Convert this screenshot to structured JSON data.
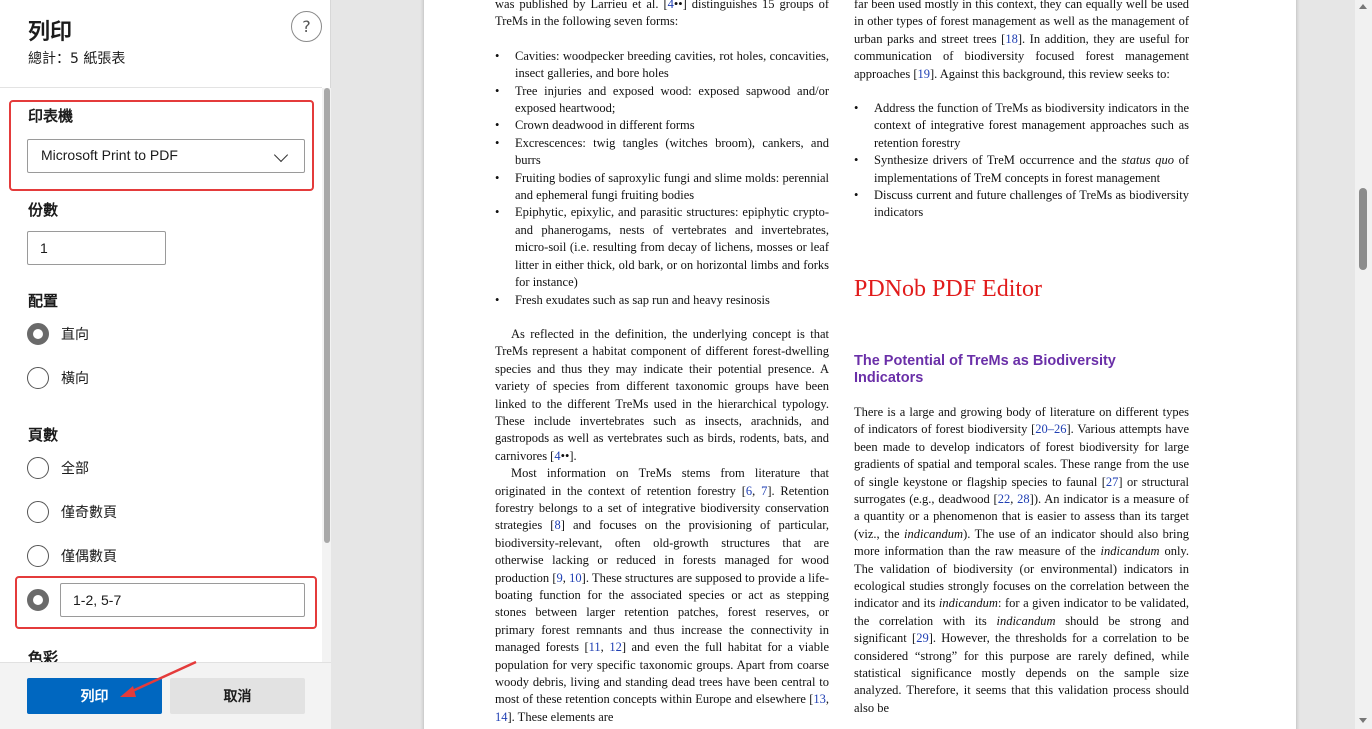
{
  "dialog": {
    "title": "列印",
    "total_sheets": "總計：5 紙張表",
    "help_icon": "question-mark-icon",
    "help_glyph": "?",
    "printer": {
      "label": "印表機",
      "value": "Microsoft Print to PDF"
    },
    "copies": {
      "label": "份數",
      "value": "1"
    },
    "layout": {
      "label": "配置",
      "options": [
        {
          "label": "直向",
          "checked": true
        },
        {
          "label": "橫向",
          "checked": false
        }
      ]
    },
    "pages": {
      "label": "頁數",
      "options": [
        {
          "label": "全部",
          "checked": false
        },
        {
          "label": "僅奇數頁",
          "checked": false
        },
        {
          "label": "僅偶數頁",
          "checked": false
        }
      ],
      "custom_checked": true,
      "custom_value": "1-2, 5-7"
    },
    "color": {
      "label": "色彩"
    },
    "print_label": "列印",
    "cancel_label": "取消",
    "highlight_color": "#e43b3b",
    "primary_color": "#0067c0"
  },
  "document": {
    "left": {
      "intro": [
        {
          "t": "was published by Larrieu et al. ["
        },
        {
          "t": "4",
          "ref": true
        },
        {
          "t": "••] distinguishes 15 groups of TreMs in the following seven forms:"
        }
      ],
      "bullets": [
        "Cavities: woodpecker breeding cavities, rot holes, concavities, insect galleries, and bore holes",
        "Tree injuries and exposed wood: exposed sapwood and/or exposed heartwood;",
        "Crown deadwood in different forms",
        "Excrescences: twig tangles (witches broom), cankers, and burrs",
        "Fruiting bodies of saproxylic fungi and slime molds: perennial and ephemeral fungi fruiting bodies",
        "Epiphytic, epixylic, and parasitic structures: epiphytic crypto- and phanerogams, nests of vertebrates and invertebrates, micro-soil (i.e. resulting from decay of lichens, mosses or leaf litter in either thick, old bark, or on horizontal limbs and forks for instance)",
        "Fresh exudates such as sap run and heavy resinosis"
      ],
      "para1": [
        {
          "t": "As reflected in the definition, the underlying concept is that TreMs represent a habitat component of different forest-dwelling species and thus they may indicate their potential presence. A variety of species from different taxonomic groups have been linked to the different TreMs used in the hierarchical typology. These include invertebrates such as insects, arachnids, and gastropods as well as vertebrates such as birds, rodents, bats, and carnivores ["
        },
        {
          "t": "4",
          "ref": true
        },
        {
          "t": "••]."
        }
      ],
      "para2": [
        {
          "t": "Most information on TreMs stems from literature that originated in the context of retention forestry ["
        },
        {
          "t": "6",
          "ref": true
        },
        {
          "t": ", "
        },
        {
          "t": "7",
          "ref": true
        },
        {
          "t": "]. Retention forestry belongs to a set of integrative biodiversity conservation strategies ["
        },
        {
          "t": "8",
          "ref": true
        },
        {
          "t": "] and focuses on the provisioning of particular, biodiversity-relevant, often old-growth structures that are otherwise lacking or reduced in forests managed for wood production ["
        },
        {
          "t": "9",
          "ref": true
        },
        {
          "t": ", "
        },
        {
          "t": "10",
          "ref": true
        },
        {
          "t": "]. These structures are supposed to provide a life-boating function for the associated species or act as stepping stones between larger retention patches, forest reserves, or primary forest remnants and thus increase the connectivity in managed forests ["
        },
        {
          "t": "11",
          "ref": true
        },
        {
          "t": ", "
        },
        {
          "t": "12",
          "ref": true
        },
        {
          "t": "] and even the full habitat for a viable population for very specific taxonomic groups. Apart from coarse woody debris, living and standing dead trees have been central to most of these retention concepts within Europe and elsewhere ["
        },
        {
          "t": "13",
          "ref": true
        },
        {
          "t": ", "
        },
        {
          "t": "14",
          "ref": true
        },
        {
          "t": "]. These elements are"
        }
      ]
    },
    "right": {
      "para0": [
        {
          "t": "far been used mostly in this context, they can equally well be used in other types of forest management as well as the management of urban parks and street trees ["
        },
        {
          "t": "18",
          "ref": true
        },
        {
          "t": "]. In addition, they are useful for communication of biodiversity focused forest management approaches ["
        },
        {
          "t": "19",
          "ref": true
        },
        {
          "t": "]. Against this background, this review seeks to:"
        }
      ],
      "bullets": [
        [
          {
            "t": "Address the function of TreMs as biodiversity indicators in the context of integrative forest management approaches such as retention forestry"
          }
        ],
        [
          {
            "t": "Synthesize drivers of TreM occurrence and the "
          },
          {
            "t": "status quo",
            "i": true
          },
          {
            "t": " of implementations of TreM concepts in forest management"
          }
        ],
        [
          {
            "t": "Discuss current and future challenges of TreMs as biodiversity indicators"
          }
        ]
      ],
      "brand": "PDNob PDF Editor",
      "section_title": "The Potential of TreMs as Biodiversity Indicators",
      "para1": [
        {
          "t": "There is a large and growing body of literature on different types of indicators of forest biodiversity ["
        },
        {
          "t": "20–26",
          "ref": true
        },
        {
          "t": "]. Various attempts have been made to develop indicators of forest biodiversity for large gradients of spatial and temporal scales. These range from the use of single keystone or flagship species to faunal ["
        },
        {
          "t": "27",
          "ref": true
        },
        {
          "t": "] or structural surrogates (e.g., deadwood ["
        },
        {
          "t": "22",
          "ref": true
        },
        {
          "t": ", "
        },
        {
          "t": "28",
          "ref": true
        },
        {
          "t": "]). An indicator is a measure of a quantity or a phenomenon that is easier to assess than its target (viz., the "
        },
        {
          "t": "indicandum",
          "i": true
        },
        {
          "t": "). The use of an indicator should also bring more information than the raw measure of the "
        },
        {
          "t": "indicandum",
          "i": true
        },
        {
          "t": " only. The validation of biodiversity (or environmental) indicators in ecological studies strongly focuses on the correlation between the indicator and its "
        },
        {
          "t": "indicandum",
          "i": true
        },
        {
          "t": ": for a given indicator to be validated, the correlation with its "
        },
        {
          "t": "indicandum",
          "i": true
        },
        {
          "t": " should be strong and significant ["
        },
        {
          "t": "29",
          "ref": true
        },
        {
          "t": "]. However, the thresholds for a correlation to be considered “strong” for this purpose are rarely defined, while statistical significance mostly depends on the sample size analyzed. Therefore, it seems that this validation process should also be"
        }
      ]
    }
  }
}
